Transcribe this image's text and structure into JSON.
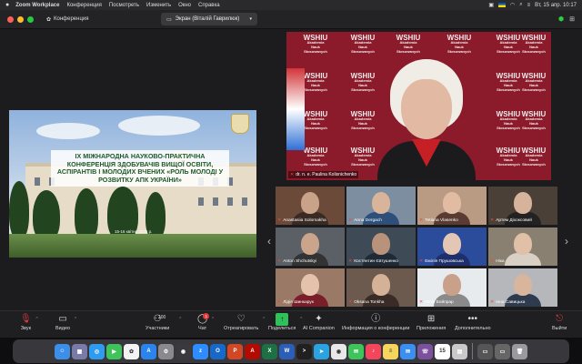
{
  "menubar": {
    "apple": "",
    "items": [
      "Zoom Workplace",
      "Конференция",
      "Посмотреть",
      "Изменить",
      "Окно",
      "Справка"
    ],
    "clock": "Вт, 15 апр.  10:17"
  },
  "window": {
    "conference_label": "Конференция",
    "screen_pill": "Экран (Віталій Гаврилюк)"
  },
  "share": {
    "banner": "IX МІЖНАРОДНА НАУКОВО-ПРАКТИЧНА КОНФЕРЕНЦІЯ ЗДОБУВАЧІВ ВИЩОЇ ОСВІТИ, АСПІРАНТІВ І МОЛОДИХ ВЧЕНИХ «РОЛЬ МОЛОДІ У РОЗВИТКУ АПК УКРАЇНИ»",
    "date": "15-16 квітня 2025 р."
  },
  "speaker": {
    "name": "dr. n. e. Paulina Kolisnichenko",
    "logo_mark": "WSHIU",
    "logo_sub": "Akademia Nauk Stosowanych"
  },
  "gallery": {
    "tiles": [
      {
        "name": "Anastasiia Solomakha",
        "bg": "#6b4a3a",
        "head": "#c9a389",
        "body": "#3a2a24"
      },
      {
        "name": "Anna Dergach",
        "bg": "#7d8ea0",
        "head": "#d8b49a",
        "body": "#2d4f7a"
      },
      {
        "name": "Tetiana Vlasenko",
        "bg": "#b99a82",
        "head": "#e1bca3",
        "body": "#5a3b32"
      },
      {
        "name": "Артем Діхоксовий",
        "bg": "#4a4038",
        "head": "#d6b39a",
        "body": "#222"
      },
      {
        "name": "Anton Shchutskyi",
        "bg": "#5b5f66",
        "head": "#caa58c",
        "body": "#333"
      },
      {
        "name": "Костянтин Євтушенко",
        "bg": "#3f4a57",
        "head": "#b8927a",
        "body": "#1e2a36"
      },
      {
        "name": "Емілія Прушовська",
        "bg": "#2b4c9b",
        "head": "#e3c6b3",
        "body": "#1f2f6b"
      },
      {
        "name": "Ніка",
        "bg": "#8a8072",
        "head": "#e0c0a6",
        "body": "#d8d0c4"
      },
      {
        "name": "Лідія Шинкарук",
        "bg": "#9a7a66",
        "head": "#e4c2ab",
        "body": "#7a1f2a"
      },
      {
        "name": "Oksana Tonkha",
        "bg": "#6d5a4e",
        "head": "#d5b198",
        "body": "#3a2b26"
      },
      {
        "name": "Юлія Бойпрар",
        "bg": "#e7ebee",
        "head": "#c9a18a",
        "body": "#8a8a8a"
      },
      {
        "name": "Інна Савицька",
        "bg": "#b5b7bb",
        "head": "#d8b59d",
        "body": "#2e3b4e"
      }
    ]
  },
  "toolbar": {
    "audio": "Звук",
    "video": "Видео",
    "participants": "Участники",
    "participants_count": "100",
    "chat": "Чат",
    "chat_badge": "1",
    "react": "Отреагировать",
    "share": "Поделиться",
    "ai": "AI Companion",
    "info": "Информация о конференции",
    "apps": "Приложения",
    "more": "Дополнительно",
    "leave": "Выйти"
  },
  "dock": {
    "icons": [
      {
        "name": "finder-icon",
        "color": "#3b8fe8",
        "glyph": "☺"
      },
      {
        "name": "launchpad-icon",
        "color": "#7a7aa8",
        "glyph": "▦"
      },
      {
        "name": "safari-icon",
        "color": "#2f9bf0",
        "glyph": "◎"
      },
      {
        "name": "facetime-icon",
        "color": "#3ec45a",
        "glyph": "▶"
      },
      {
        "name": "photos-icon",
        "color": "#f3f3f3",
        "glyph": "✿"
      },
      {
        "name": "appstore-icon",
        "color": "#2a84f0",
        "glyph": "A"
      },
      {
        "name": "settings-icon",
        "color": "#8a8a8e",
        "glyph": "⚙"
      },
      {
        "name": "chrome-icon",
        "color": "#3a3a3e",
        "glyph": "◉"
      },
      {
        "name": "zoom-icon",
        "color": "#2d8cff",
        "glyph": "z"
      },
      {
        "name": "outlook-icon",
        "color": "#1669c8",
        "glyph": "O"
      },
      {
        "name": "powerpoint-icon",
        "color": "#d24726",
        "glyph": "P"
      },
      {
        "name": "acrobat-icon",
        "color": "#b30b00",
        "glyph": "A"
      },
      {
        "name": "excel-icon",
        "color": "#1d7044",
        "glyph": "X"
      },
      {
        "name": "word-icon",
        "color": "#2b5eb7",
        "glyph": "W"
      },
      {
        "name": "terminal-icon",
        "color": "#202020",
        "glyph": ">"
      },
      {
        "name": "telegram-icon",
        "color": "#2aa3e0",
        "glyph": "➤"
      },
      {
        "name": "chrome-icon",
        "color": "#e8e8e8",
        "glyph": "◉"
      },
      {
        "name": "messages-icon",
        "color": "#3ec45a",
        "glyph": "✉"
      },
      {
        "name": "music-icon",
        "color": "#f3465a",
        "glyph": "♪"
      },
      {
        "name": "notes-icon",
        "color": "#f6d55c",
        "glyph": "≡"
      },
      {
        "name": "mail-icon",
        "color": "#3a8ff0",
        "glyph": "✉"
      },
      {
        "name": "viber-icon",
        "color": "#7b519d",
        "glyph": "☏"
      },
      {
        "name": "calendar-icon",
        "color": "#ffffff",
        "glyph": "15"
      },
      {
        "name": "preview-icon",
        "color": "#c9c9cc",
        "glyph": "▤"
      },
      {
        "name": "window-icon",
        "color": "#555",
        "glyph": "▭"
      },
      {
        "name": "window-icon",
        "color": "#666",
        "glyph": "▭"
      },
      {
        "name": "trash-icon",
        "color": "#9a9a9e",
        "glyph": "🗑"
      }
    ]
  }
}
